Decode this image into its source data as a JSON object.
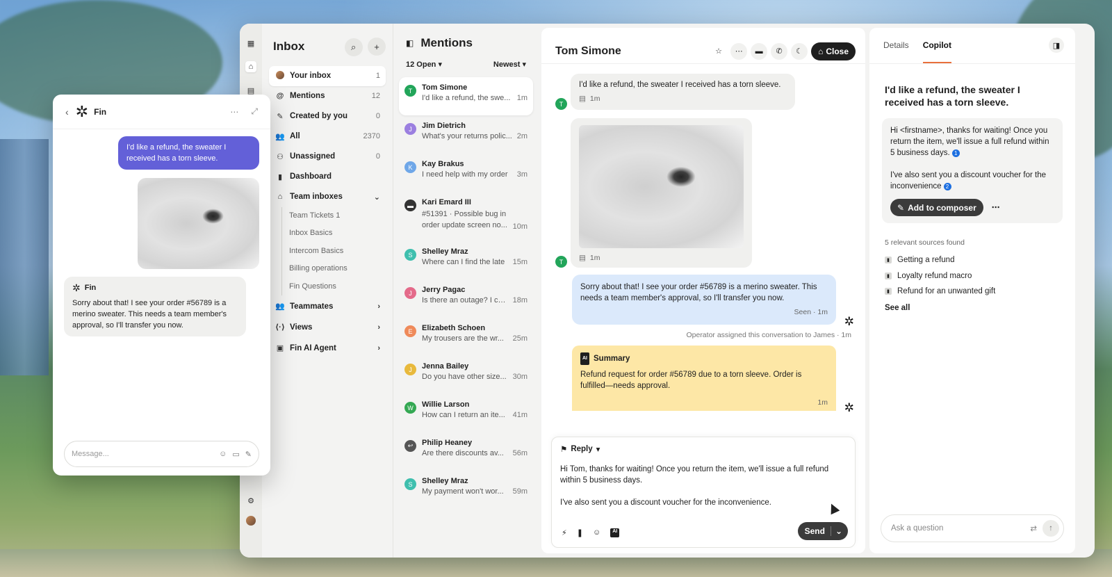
{
  "inbox": {
    "title": "Inbox",
    "nav": [
      {
        "label": "Your inbox",
        "count": "1",
        "icon": "avatar"
      },
      {
        "label": "Mentions",
        "count": "12",
        "icon": "@"
      },
      {
        "label": "Created by you",
        "count": "0",
        "icon": "✎"
      },
      {
        "label": "All",
        "count": "2370",
        "icon": "👥"
      },
      {
        "label": "Unassigned",
        "count": "0",
        "icon": "⚇"
      },
      {
        "label": "Dashboard",
        "count": "",
        "icon": "▮"
      }
    ],
    "team_inboxes": {
      "label": "Team inboxes",
      "items": [
        "Team Tickets 1",
        "Inbox Basics",
        "Intercom Basics",
        "Billing operations",
        "Fin Questions"
      ]
    },
    "sections": [
      {
        "label": "Teammates",
        "icon": "👥"
      },
      {
        "label": "Views",
        "icon": "⟨·⟩"
      },
      {
        "label": "Fin AI Agent",
        "icon": "▣"
      }
    ]
  },
  "mentions": {
    "title": "Mentions",
    "open_filter": "12 Open",
    "sort": "Newest",
    "conversations": [
      {
        "initial": "T",
        "name": "Tom Simone",
        "preview": "I'd like a refund, the swe...",
        "time": "1m",
        "color": "#22a55a"
      },
      {
        "initial": "J",
        "name": "Jim Dietrich",
        "preview": "What's your returns polic...",
        "time": "2m",
        "color": "#9b7fe0"
      },
      {
        "initial": "K",
        "name": "Kay Brakus",
        "preview": "I need help with my order",
        "time": "3m",
        "color": "#6fa7e8"
      },
      {
        "initial": "▬",
        "name": "Kari Emard III",
        "preview": "#51391 · Possible bug in order update screen no...",
        "time": "10m",
        "color": "#333333"
      },
      {
        "initial": "S",
        "name": "Shelley Mraz",
        "preview": "Where can I find the late",
        "time": "15m",
        "color": "#3fbfae"
      },
      {
        "initial": "J",
        "name": "Jerry Pagac",
        "preview": "Is there an outage? I ca...",
        "time": "18m",
        "color": "#e46a8a"
      },
      {
        "initial": "E",
        "name": "Elizabeth Schoen",
        "preview": "My trousers are the wr...",
        "time": "25m",
        "color": "#ef8a5a"
      },
      {
        "initial": "J",
        "name": "Jenna Bailey",
        "preview": "Do you have other size...",
        "time": "30m",
        "color": "#e8b93c"
      },
      {
        "initial": "W",
        "name": "Willie Larson",
        "preview": "How can I return an ite...",
        "time": "41m",
        "color": "#34a853"
      },
      {
        "initial": "↩",
        "name": "Philip Heaney",
        "preview": "Are there discounts av...",
        "time": "56m",
        "color": "#555555"
      },
      {
        "initial": "S",
        "name": "Shelley Mraz",
        "preview": "My payment won't wor...",
        "time": "59m",
        "color": "#3fbfae"
      }
    ]
  },
  "conversation": {
    "title": "Tom Simone",
    "close_label": "Close",
    "customer_message": "I'd like a refund, the sweater I received has a torn sleeve.",
    "customer_time": "1m",
    "image_time": "1m",
    "fin_reply": "Sorry about that! I see your order #56789 is a merino sweater. This needs a team member's approval, so I'll transfer you now.",
    "fin_reply_status": "Seen · 1m",
    "system_line": "Operator assigned this conversation to James · 1m",
    "summary_label": "Summary",
    "summary_text": "Refund request for order #56789 due to a torn sleeve. Order is fulfilled—needs approval.",
    "summary_time": "1m",
    "composer": {
      "mode": "Reply",
      "text1": "Hi Tom, thanks for waiting! Once you return the item, we'll issue a full refund within 5 business days.",
      "text2": "I've also sent you a discount voucher for the inconvenience.",
      "send_label": "Send"
    }
  },
  "copilot": {
    "tabs": [
      "Details",
      "Copilot"
    ],
    "question": "I'd like a refund, the sweater I received has a torn sleeve.",
    "answer1": "Hi <firstname>, thanks for waiting! Once you return the item, we'll issue a full refund within 5 business days.",
    "answer2": "I've also sent you a discount voucher for the inconvenience",
    "ref1": "1",
    "ref2": "2",
    "add_label": "Add to composer",
    "sources_heading": "5 relevant sources found",
    "sources": [
      "Getting a refund",
      "Loyalty refund macro",
      "Refund for an unwanted gift"
    ],
    "see_all": "See all",
    "ask_placeholder": "Ask a question"
  },
  "messenger": {
    "name": "Fin",
    "user_message": "I'd like a refund, the sweater I received has a torn sleeve.",
    "fin_name": "Fin",
    "fin_message": "Sorry about that! I see your order #56789 is a merino sweater. This needs a team member's approval, so I'll transfer you now.",
    "input_placeholder": "Message..."
  }
}
